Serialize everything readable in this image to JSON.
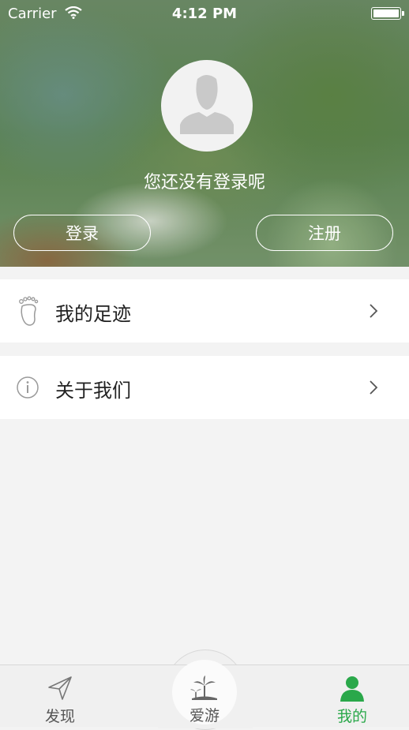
{
  "status_bar": {
    "carrier": "Carrier",
    "time": "4:12 PM"
  },
  "profile": {
    "login_prompt": "您还没有登录呢",
    "login_button": "登录",
    "register_button": "注册"
  },
  "menu": {
    "items": [
      {
        "label": "我的足迹",
        "icon": "footprint-icon"
      },
      {
        "label": "关于我们",
        "icon": "info-icon"
      }
    ]
  },
  "tabbar": {
    "tabs": [
      {
        "label": "发现",
        "icon": "paper-plane-icon"
      },
      {
        "label": "爱游",
        "icon": "palm-island-icon"
      },
      {
        "label": "我的",
        "icon": "person-icon",
        "active": true
      }
    ],
    "active_color": "#2aa84a"
  }
}
